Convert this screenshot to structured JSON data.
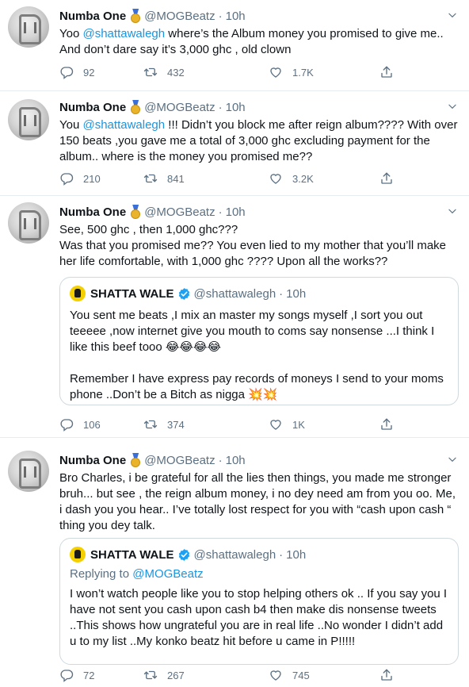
{
  "tweets": [
    {
      "name": "Numba One",
      "handle": "@MOGBeatz",
      "dot": "·",
      "time": "10h",
      "text_pre": "Yoo ",
      "mention": "@shattawalegh",
      "text_post": " where’s the Album money you promised to give me.. And don’t dare say it’s 3,000 ghc , old clown",
      "replies": "92",
      "retweets": "432",
      "likes": "1.7K"
    },
    {
      "name": "Numba One",
      "handle": "@MOGBeatz",
      "dot": "·",
      "time": "10h",
      "text_pre": "You ",
      "mention": "@shattawalegh",
      "text_post": " !!! Didn’t you block me after reign album???? With over 150 beats ,you gave me a total of 3,000 ghc excluding payment for the album.. where is the money you promised me??",
      "replies": "210",
      "retweets": "841",
      "likes": "3.2K"
    },
    {
      "name": "Numba One",
      "handle": "@MOGBeatz",
      "dot": "·",
      "time": "10h",
      "text": "See, 500 ghc , then 1,000 ghc???\nWas that you promised me?? You even lied to my mother that you’ll make her life comfortable, with 1,000 ghc ???? Upon all the works??",
      "quote": {
        "name": "SHATTA WALE",
        "handle": "@shattawalegh",
        "dot": "·",
        "time": "10h",
        "text": "You sent me beats ,I mix an master my songs myself ,I sort you out teeeee ,now internet give you mouth to coms say nonsense ...I think I like this beef tooo 😂😂😂😂\n\nRemember I have express pay records of moneys I send to your moms phone ..Don’t be a Bitch as nigga 💥💥"
      },
      "replies": "106",
      "retweets": "374",
      "likes": "1K"
    },
    {
      "name": "Numba One",
      "handle": "@MOGBeatz",
      "dot": "·",
      "time": "10h",
      "text": "Bro Charles, i be grateful for all the lies then things, you made me stronger bruh... but see , the reign album money, i no dey need am from you oo. Me, i dash you you hear.. I’ve totally lost respect for you with  “cash upon cash “ thing you dey talk.",
      "quote": {
        "name": "SHATTA WALE",
        "handle": "@shattawalegh",
        "dot": "·",
        "time": "10h",
        "reply_prefix": "Replying to ",
        "reply_to": "@MOGBeatz",
        "text": "I won’t watch people like you to stop helping others  ok .. If you say you I have not sent you cash upon cash b4 then make  dis nonsense tweets ..This shows how ungrateful you are in real life ..No wonder I didn’t add u to my list ..My konko beatz hit before u came in P!!!!!"
      },
      "replies": "72",
      "retweets": "267",
      "likes": "745"
    }
  ],
  "icons": {
    "reply": "reply-icon",
    "retweet": "retweet-icon",
    "like": "heart-icon",
    "share": "share-icon",
    "caret": "chevron-down-icon",
    "medal": "medal-icon",
    "verified": "verified-badge-icon"
  },
  "colors": {
    "mention": "#1b95e0",
    "secondary": "#5b7083",
    "verified": "#1da1f2",
    "divider": "#e6ecf0"
  }
}
